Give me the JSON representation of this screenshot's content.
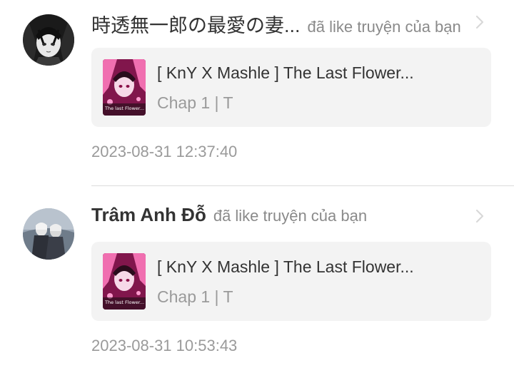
{
  "notifications": [
    {
      "username": "時透無一郎の最愛の妻...",
      "action": "đã like truyện của bạn",
      "avatar_icon": "anime-avatar-dark",
      "story_title": "[ KnY X Mashle ] The Last Flower...",
      "story_sub": "Chap 1 | T",
      "cover_text": "The last Flower...",
      "timestamp": "2023-08-31 12:37:40"
    },
    {
      "username": "Trâm Anh Đỗ",
      "action": "đã like truyện của bạn",
      "avatar_icon": "two-figures-avatar",
      "story_title": "[ KnY X Mashle ] The Last Flower...",
      "story_sub": "Chap 1 | T",
      "cover_text": "The last Flower...",
      "timestamp": "2023-08-31 10:53:43"
    }
  ],
  "colors": {
    "text_primary": "#333333",
    "text_secondary": "#8a8a8a",
    "card_bg": "#f3f3f3",
    "cover_accent": "#d61f7a"
  }
}
